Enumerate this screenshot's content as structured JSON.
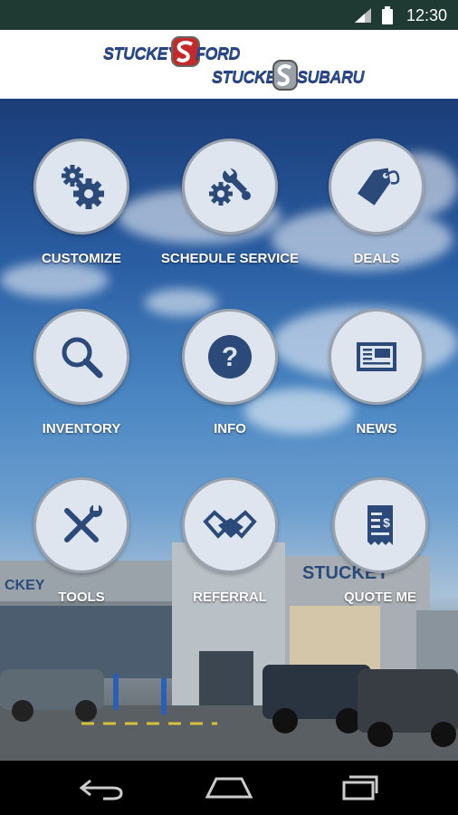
{
  "status_bar": {
    "time": "12:30"
  },
  "header": {
    "logo_line1_a": "STUCKEY",
    "logo_line1_b": "FORD",
    "logo_line2_a": "STUCKEY",
    "logo_line2_b": "SUBARU"
  },
  "menu": [
    {
      "label": "CUSTOMIZE",
      "icon": "gears-icon"
    },
    {
      "label": "SCHEDULE SERVICE",
      "icon": "wrench-gear-icon"
    },
    {
      "label": "DEALS",
      "icon": "tag-icon"
    },
    {
      "label": "INVENTORY",
      "icon": "search-icon"
    },
    {
      "label": "INFO",
      "icon": "question-icon"
    },
    {
      "label": "NEWS",
      "icon": "newspaper-icon"
    },
    {
      "label": "TOOLS",
      "icon": "tools-icon"
    },
    {
      "label": "REFERRAL",
      "icon": "handshake-icon"
    },
    {
      "label": "QUOTE ME",
      "icon": "receipt-icon"
    }
  ],
  "background": {
    "sign_text": "STUCKEY"
  },
  "colors": {
    "icon_blue": "#2b4a7a",
    "circle_fill": "#dfe5ee",
    "status_bar": "#1f3a33"
  }
}
